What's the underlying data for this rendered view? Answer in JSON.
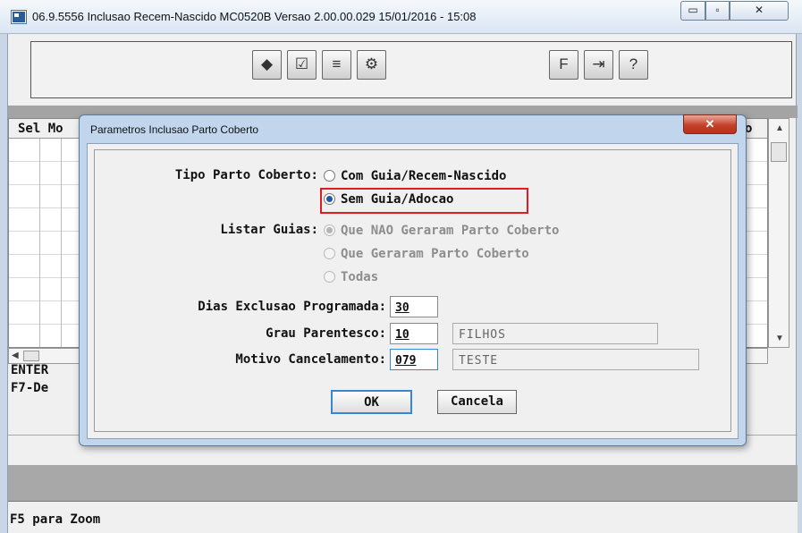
{
  "window": {
    "title": "06.9.5556 Inclusao Recem-Nascido MC0520B Versao 2.00.00.029 15/01/2016 - 15:08",
    "controls": {
      "minimize": "▭",
      "maximize": "▫",
      "close": "✕"
    }
  },
  "toolbar": {
    "buttons": [
      {
        "icon": "diamond-hand-icon",
        "glyph": "◆"
      },
      {
        "icon": "checklist-icon",
        "glyph": "☑"
      },
      {
        "icon": "list-icon",
        "glyph": "≡"
      },
      {
        "icon": "gears-icon",
        "glyph": "⚙"
      },
      {
        "icon": "f-key-icon",
        "glyph": "F"
      },
      {
        "icon": "exit-door-icon",
        "glyph": "⇥"
      },
      {
        "icon": "help-icon",
        "glyph": "?"
      }
    ]
  },
  "background": {
    "grid_header_left": "Sel Mo",
    "grid_header_right": "o",
    "hint_line_1": "ENTER",
    "hint_line_2": "F7-De",
    "status": "F5 para Zoom"
  },
  "dialog": {
    "title": "Parametros Inclusao Parto Coberto",
    "close_label": "✕",
    "tipo_parto": {
      "label": "Tipo Parto Coberto:",
      "options": [
        "Com Guia/Recem-Nascido",
        "Sem Guia/Adocao"
      ],
      "selected": "Sem Guia/Adocao"
    },
    "listar_guias": {
      "label": "Listar Guias:",
      "options": [
        "Que NAO Geraram Parto Coberto",
        "Que Geraram Parto Coberto",
        "Todas"
      ],
      "selected": "Que NAO Geraram Parto Coberto"
    },
    "dias_exclusao": {
      "label": "Dias Exclusao Programada:",
      "value": "30"
    },
    "grau_parentesco": {
      "label": "Grau Parentesco:",
      "value": "10",
      "description": "FILHOS"
    },
    "motivo_cancelamento": {
      "label": "Motivo Cancelamento:",
      "value": "079",
      "description": "TESTE"
    },
    "ok_label": "OK",
    "cancel_label": "Cancela"
  }
}
